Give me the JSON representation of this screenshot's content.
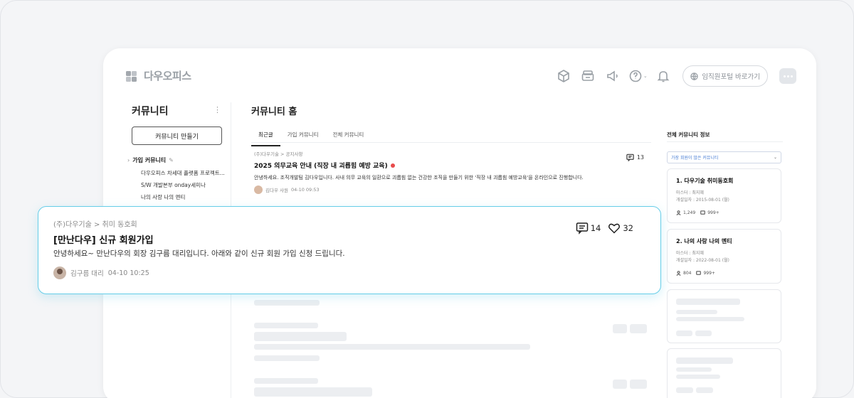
{
  "app": {
    "logo_text": "다우오피스"
  },
  "header": {
    "icons": [
      "box-icon",
      "printer-icon",
      "megaphone-icon",
      "help-icon",
      "bell-icon"
    ],
    "portal_label": "임직원포털 바로가기"
  },
  "sidebar": {
    "title": "커뮤니티",
    "create_button": "커뮤니티 만들기",
    "group_label": "가입 커뮤니티",
    "items": [
      {
        "label": "다우오피스 차세대 플랫폼 프로젝트..."
      },
      {
        "label": "S/W 개발본부 onday세미나"
      },
      {
        "label": "나의 사랑 나의 멘티"
      }
    ]
  },
  "main": {
    "title": "커뮤니티 홈",
    "tabs": [
      {
        "label": "최근글"
      },
      {
        "label": "가입 커뮤니티"
      },
      {
        "label": "전체 커뮤니티"
      }
    ],
    "post1": {
      "crumb": "(주)다우기술 > 공지사항",
      "title": "2025 의무교육 안내 (직장 내 괴롭힘 예방 교육)",
      "body": "안녕하세요. 조직개발팀 김다우입니다. 사내 의무 교육의 일환으로 괴롭힘 없는 건강한 조직을 만들기 위한 '직장 내 괴롭힘 예방교육'을 온라인으로 진행합니다.",
      "author": "김다우 사원",
      "date": "04-10 09:53",
      "comments": "13"
    }
  },
  "right_panel": {
    "title": "전체 커뮤니티 정보",
    "select_value": "가장 회원이 많은 커뮤니티",
    "cards": [
      {
        "name": "1. 다우기술 취미동호회",
        "master": "마스터 : 최지혜",
        "opened": "개설일자 : 2015-08-01 (월)",
        "members": "1,249",
        "posts": "999+"
      },
      {
        "name": "2. 나의 사랑 나의 멘티",
        "master": "마스터 : 최지혜",
        "opened": "개설일자 : 2022-08-01 (월)",
        "members": "804",
        "posts": "999+"
      }
    ]
  },
  "highlight": {
    "crumb": "(주)다우기술 > 취미 동호회",
    "title": "[만난다우] 신규 회원가입",
    "body": "안녕하세요~ 만난다우의 회장 김구름 대리입니다. 아래와 같이 신규 회원 가입 신청 드립니다.",
    "author": "김구름 대리",
    "date": "04-10 10:25",
    "comments": "14",
    "likes": "32"
  },
  "colors": {
    "highlight_border": "#66cde8",
    "badge_red": "#e84b4b",
    "link_blue": "#4a7fd4"
  }
}
